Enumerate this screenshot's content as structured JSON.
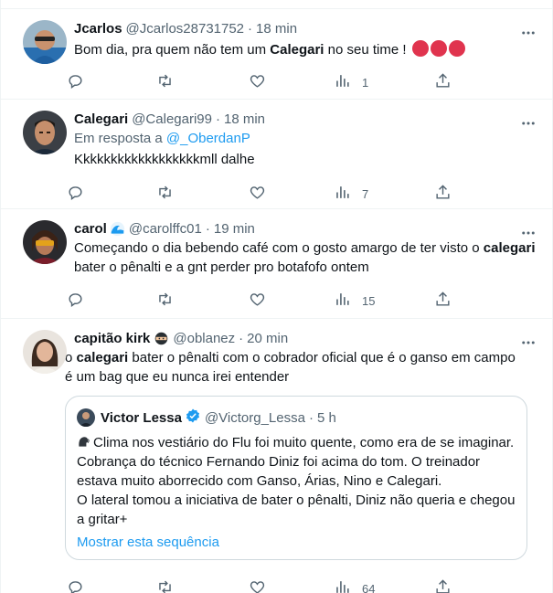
{
  "tweets": [
    {
      "name": "Jcarlos",
      "handle": "@Jcarlos28731752",
      "sep": "·",
      "time": "18 min",
      "text_before": "Bom dia, pra quem não tem um ",
      "text_bold": "Calegari",
      "text_after": " no seu time ! ",
      "views": "1"
    },
    {
      "name": "Calegari",
      "handle": "@Calegari99",
      "sep": "·",
      "time": "18 min",
      "reply_prefix": "Em resposta a ",
      "reply_to": "@_OberdanP",
      "text": "Kkkkkkkkkkkkkkkkkkmll dalhe",
      "views": "7"
    },
    {
      "name": "carol",
      "handle": "@carolffc01",
      "sep": "·",
      "time": "19 min",
      "line1_before": "Começando o dia bebendo café com o gosto amargo de ter visto o ",
      "line1_bold": "calegari",
      "line2": "bater o pênalti e a gnt perder pro botafofo ontem",
      "views": "15"
    },
    {
      "name": "capitão kirk",
      "handle": "@oblanez",
      "sep": "·",
      "time": "20 min",
      "line1_before": "o ",
      "line1_bold": "calegari",
      "line1_after": " bater o pênalti com o cobrador oficial que é o ganso em campo",
      "line2": "é um bag que eu nunca irei entender",
      "views": "64",
      "quote": {
        "name": "Victor Lessa",
        "handle": "@Victorg_Lessa",
        "sep": "·",
        "time": "5 h",
        "lines": [
          "Clima nos vestiário do Flu foi muito quente, como era de se imaginar.",
          "Cobrança do técnico Fernando Diniz foi acima do tom. O treinador",
          "estava muito aborrecido com Ganso, Árias, Nino e Calegari.",
          "O lateral tomou a iniciativa de bater o pênalti, Diniz não queria e chegou",
          "a gritar+"
        ],
        "show_thread": "Mostrar esta sequência"
      }
    }
  ],
  "icons": {
    "reply": "reply-icon",
    "retweet": "retweet-icon",
    "like": "heart-icon",
    "views": "views-icon",
    "share": "share-icon",
    "more": "more-icon"
  },
  "colors": {
    "accent": "#1d9bf0",
    "muted": "#536471",
    "text": "#0f1419",
    "border": "#eff3f4"
  }
}
